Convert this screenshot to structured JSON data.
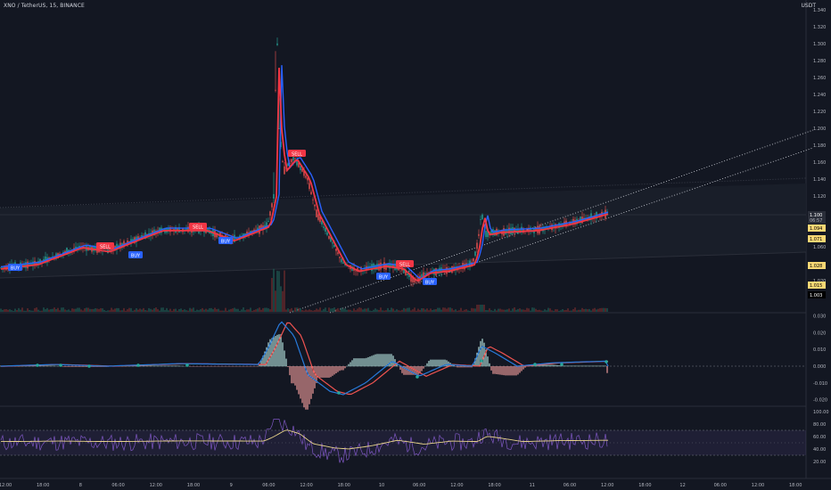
{
  "header": {
    "title": "XNO / TetherUS, 15, BINANCE",
    "currency": "USDT"
  },
  "price_axis": {
    "ticks": [
      "1.340",
      "1.320",
      "1.300",
      "1.280",
      "1.260",
      "1.240",
      "1.220",
      "1.200",
      "1.180",
      "1.160",
      "1.140",
      "1.120",
      "1.100",
      "1.080",
      "1.060",
      "1.040",
      "1.020"
    ],
    "labels": [
      {
        "text": "1.100",
        "bg": "#2a2e39",
        "fg": "#ffffff"
      },
      {
        "text": "06:57",
        "bg": "#2a2e39",
        "fg": "#b2b5be"
      },
      {
        "text": "1.094",
        "bg": "#f7d774",
        "fg": "#000000"
      },
      {
        "text": "1.071",
        "bg": "#f7d774",
        "fg": "#000000"
      },
      {
        "text": "1.028",
        "bg": "#f7d774",
        "fg": "#000000"
      },
      {
        "text": "1.015",
        "bg": "#f7d774",
        "fg": "#000000"
      },
      {
        "text": "1.003",
        "bg": "#000000",
        "fg": "#ffffff"
      }
    ]
  },
  "macd_axis": {
    "ticks": [
      "0.030",
      "0.020",
      "0.010",
      "0.000",
      "-0.010",
      "-0.020"
    ]
  },
  "rsi_axis": {
    "ticks": [
      "100.00",
      "80.00",
      "60.00",
      "40.00",
      "20.00"
    ]
  },
  "time_axis": {
    "ticks": [
      "12:00",
      "18:00",
      "8",
      "06:00",
      "12:00",
      "18:00",
      "9",
      "06:00",
      "12:00",
      "18:00",
      "10",
      "06:00",
      "12:00",
      "18:00",
      "11",
      "06:00",
      "12:00",
      "18:00",
      "12",
      "06:00",
      "12:00",
      "18:00"
    ]
  },
  "signals": [
    {
      "type": "BUY",
      "text": "BUY",
      "color": "#2962ff"
    },
    {
      "type": "SELL",
      "text": "SELL",
      "color": "#f23645"
    },
    {
      "type": "BUY",
      "text": "BUY",
      "color": "#2962ff"
    },
    {
      "type": "SELL",
      "text": "SELL",
      "color": "#f23645"
    },
    {
      "type": "BUY",
      "text": "BUY",
      "color": "#2962ff"
    },
    {
      "type": "SELL",
      "text": "SELL",
      "color": "#f23645"
    },
    {
      "type": "BUY",
      "text": "BUY",
      "color": "#2962ff"
    },
    {
      "type": "SELL",
      "text": "SELL",
      "color": "#f23645"
    },
    {
      "type": "BUY",
      "text": "BUY",
      "color": "#2962ff"
    }
  ],
  "colors": {
    "background": "#131722",
    "up": "#26a69a",
    "down": "#ef5350",
    "red_line": "#f23645",
    "blue_line": "#2962ff",
    "rsi_line": "#7e57c2",
    "rsi_ma": "#e8d48a",
    "macd_line": "#2962ff",
    "signal_line": "#ff6d00"
  }
}
